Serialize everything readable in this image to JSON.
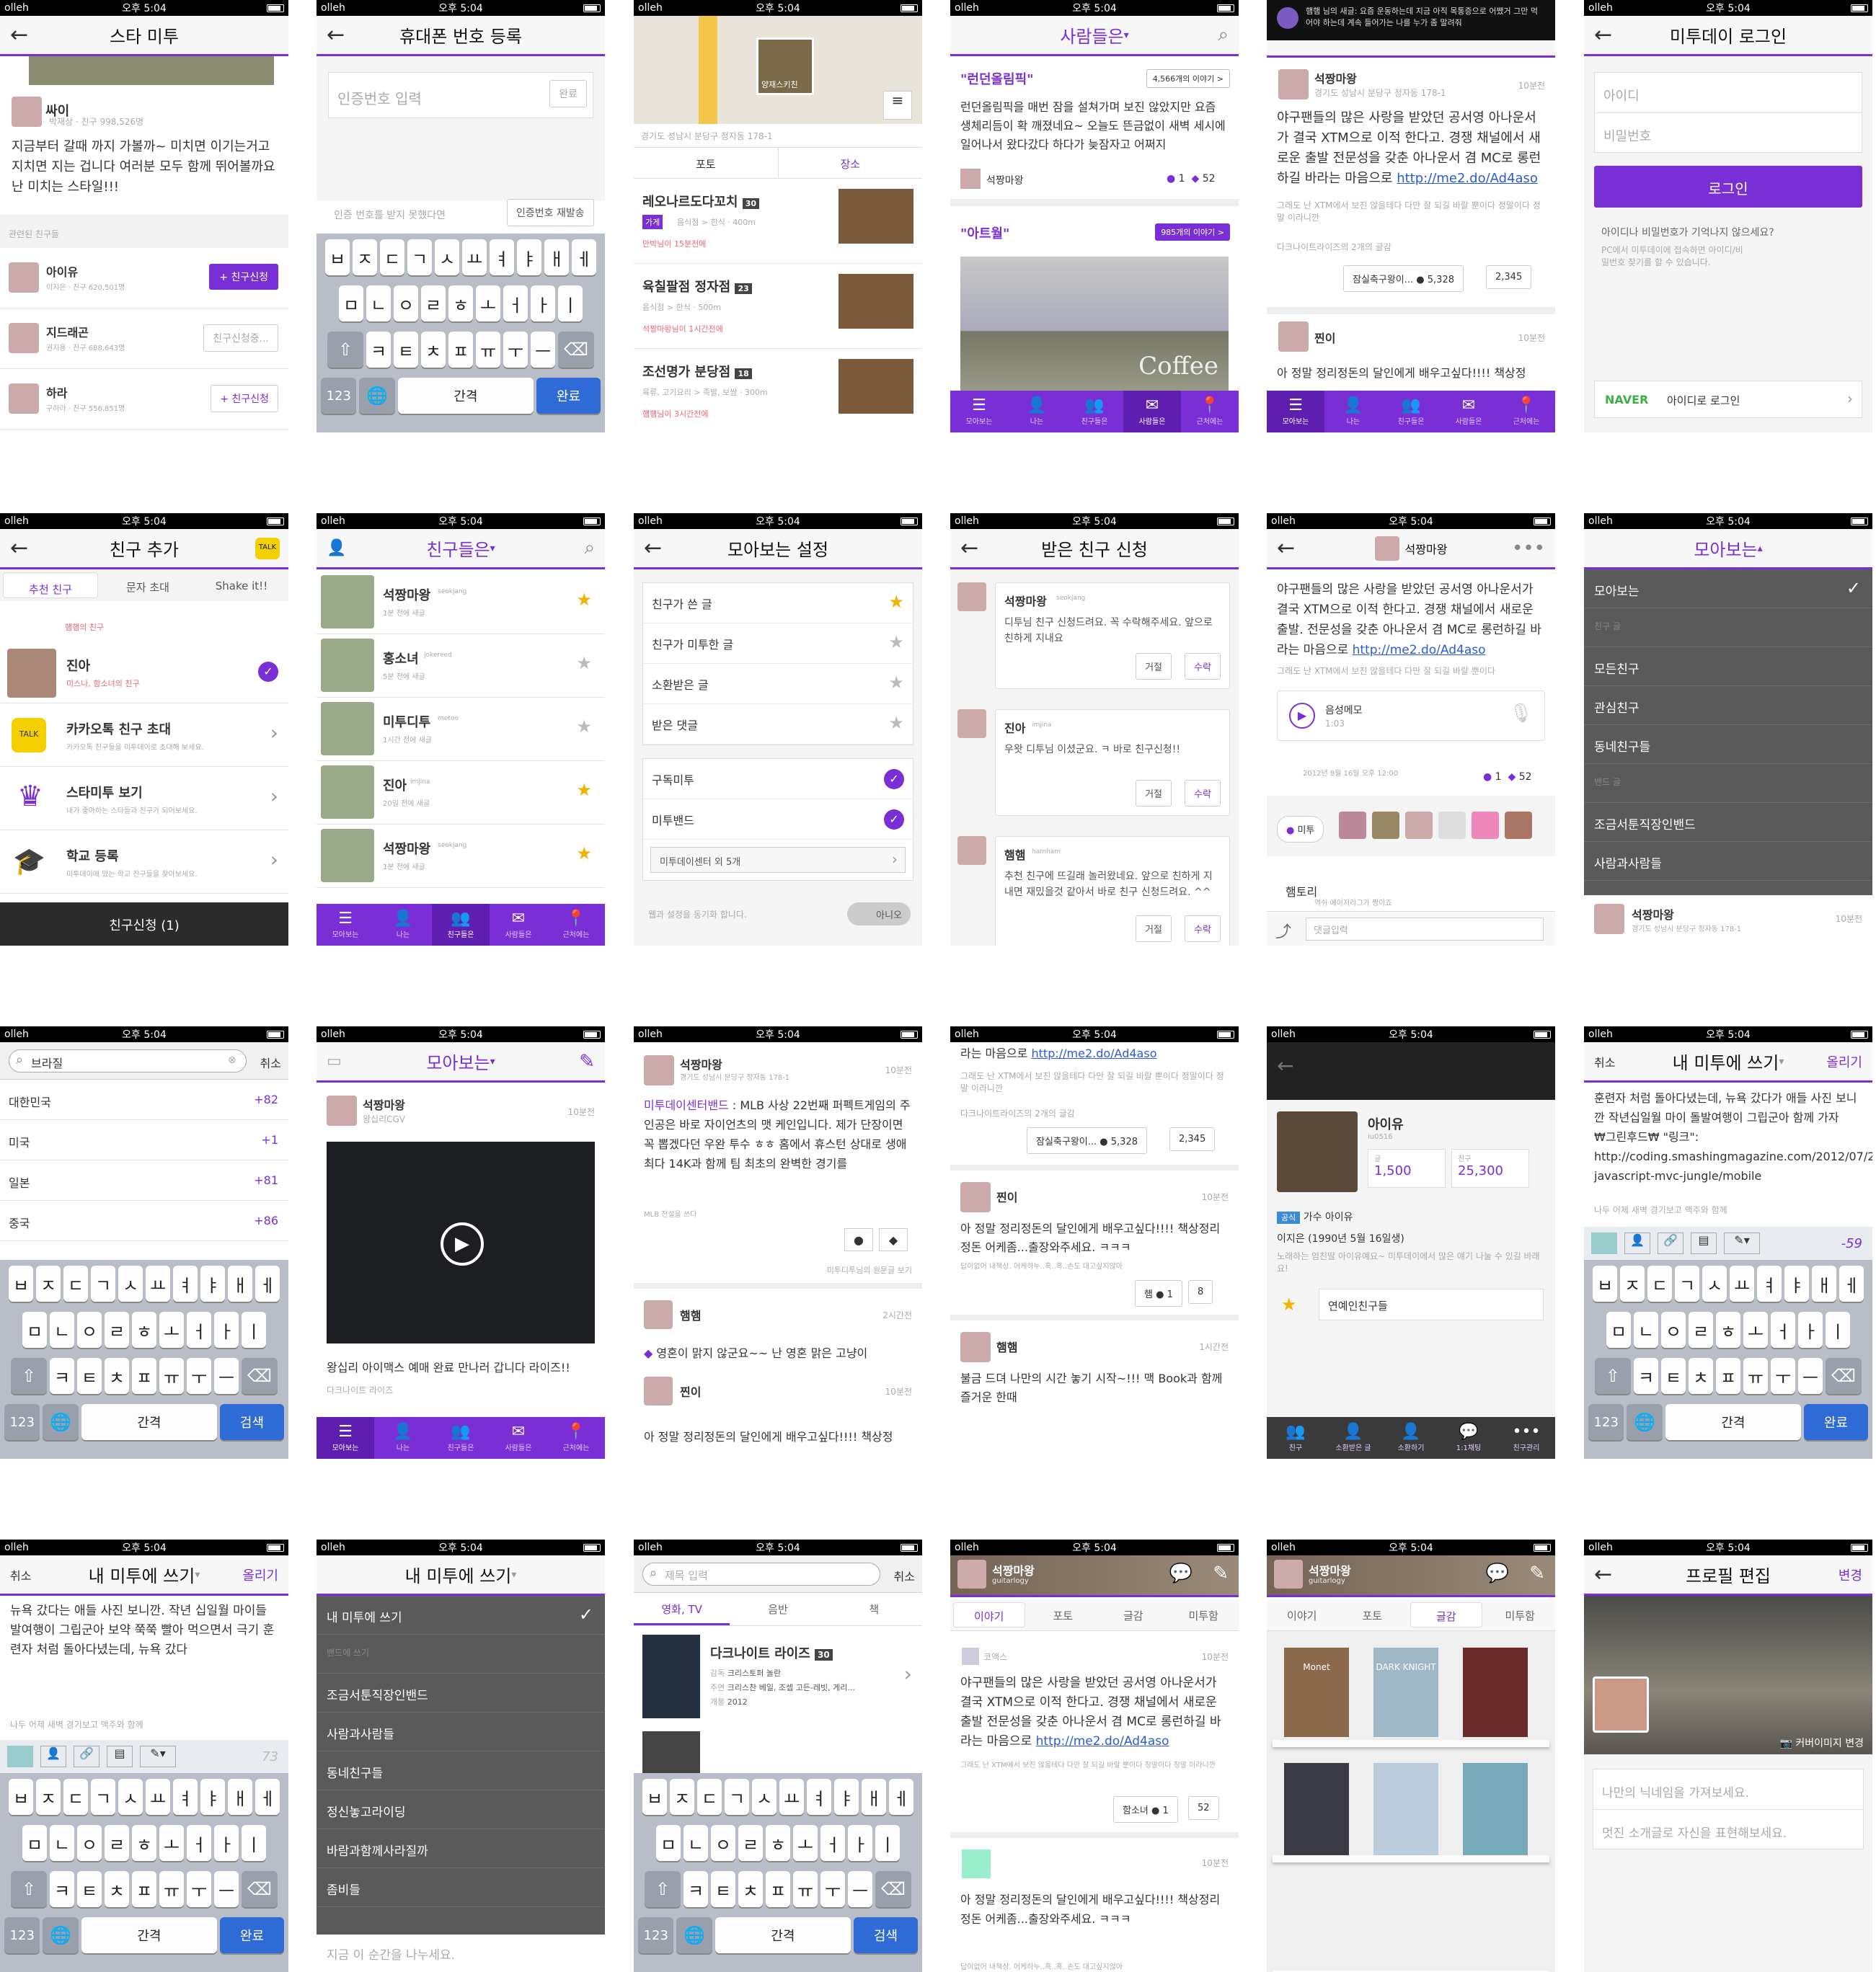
{
  "status": {
    "carrier": "olleh",
    "time": "오후 5:04"
  },
  "tabs": [
    "모아보는",
    "나는",
    "친구들은",
    "사람들은",
    "근처에는"
  ],
  "kb": {
    "r1": [
      "ㅂ",
      "ㅈ",
      "ㄷ",
      "ㄱ",
      "ㅅ",
      "ㅛ",
      "ㅕ",
      "ㅑ",
      "ㅐ",
      "ㅔ"
    ],
    "r2": [
      "ㅁ",
      "ㄴ",
      "ㅇ",
      "ㄹ",
      "ㅎ",
      "ㅗ",
      "ㅓ",
      "ㅏ",
      "ㅣ"
    ],
    "r3": [
      "ㅋ",
      "ㅌ",
      "ㅊ",
      "ㅍ",
      "ㅠ",
      "ㅜ",
      "ㅡ"
    ],
    "num": "123",
    "space": "간격",
    "done": "완료",
    "search": "검색"
  },
  "s1": {
    "title": "스타 미투",
    "name": "싸이",
    "meta": "박재상 · 친구 998,526명",
    "post": "지금부터 갈때 까지 가볼까~ 미치면 이기는거고 지치면 지는 겁니다 여러분 모두 함께 뛰어볼까요 난 미치는 스타일!!!",
    "section": "관련된 친구들",
    "friends": [
      {
        "n": "아이유",
        "m": "이지은 · 친구 620,501명",
        "b": "+ 친구신청"
      },
      {
        "n": "지드래곤",
        "m": "권지용 · 친구 688,643명",
        "b": "친구신청중..."
      },
      {
        "n": "하라",
        "m": "구하라 · 친구 556,851명",
        "b": "+ 친구신청"
      }
    ]
  },
  "s2": {
    "title": "휴대폰 번호 등록",
    "ph": "인증번호 입력",
    "ok": "완료",
    "q": "인증 번호를 받지 못했다면",
    "resend": "인증번호 재발송"
  },
  "s3": {
    "addr": "경기도 성남시 분당구 정자동 178-1",
    "tabs": [
      "포토",
      "장소"
    ],
    "pin": "양재스키친",
    "items": [
      {
        "n": "레오나르도다꼬치",
        "c": "30",
        "t": "가게",
        "m": "음식점 > 한식 · 400m",
        "w": "만박님이 15분전에"
      },
      {
        "n": "육칠팔점 정자점",
        "c": "23",
        "m": "음식점 > 한식 · 500m",
        "w": "석짱마왕님이 1시간전에"
      },
      {
        "n": "조선명가 분당점",
        "c": "18",
        "m": "육류, 고기요리 > 족발, 보쌈 · 300m",
        "w": "햄햄님이 3시간전에"
      }
    ]
  },
  "s4": {
    "title": "사람들은",
    "k1": "\"런던올림픽\"",
    "c1": "4,566개의 이야기 >",
    "p1": "런던올림픽을 매번 잠을 설쳐가며 보진 않았지만 요즘 생체리듬이 확 깨졌네요~ 오늘도 뜬금없이 새벽 세시에 일어나서 왔다갔다 하다가 늦잠자고 어쩌지",
    "u1": "석짱마왕",
    "l1": "1",
    "r1": "52",
    "k2": "\"아트월\"",
    "c2": "985개의 이야기 >",
    "img": "Coffee"
  },
  "s5": {
    "notice": "햄햄 님의 새글: 요즘 운동하는데 지금 아직 목통증으로 어쨌거 그만 먹어야 하는데 계속 들어가는 나를 누가 좀 말려줘",
    "u": "석짱마왕",
    "addr": "경기도 성남시 분당구 정자동 178-1",
    "time": "10분전",
    "post": "야구팬들의 많은 사랑을 받았던 공서영 아나운서가 결국 XTM으로 이적 한다고. 경쟁 채널에서 새로운 출발 전문성을 갖춘 아나운서 겸 MC로 롱런하길 바라는 마음으로",
    "link": "http://me2.do/Ad4aso",
    "sub": "그래도 난 XTM에서 보진 않을테다 다만 잘 되길 바랄 뿐이다 정말이다 정말 이라니깐",
    "tag": "다크나이트라이즈의 2개의 글감",
    "b1": "잠실축구왕이... ● 5,328",
    "b2": "2,345",
    "u2": "찐이",
    "t2": "10분전",
    "p2": "아 정말 정리정돈의 달인에게 배우고싶다!!!! 책상정"
  },
  "s6": {
    "title": "미투데이 로그인",
    "id": "아이디",
    "pw": "비밀번호",
    "login": "로그인",
    "q": "아이디나 비밀번호가 기억나지 않으세요?",
    "help": "PC에서 미투데이에 접속하면 아이디/비밀번호 찾기를 할 수 있습니다.",
    "naver": "NAVER",
    "nlogin": "아이디로 로그인"
  },
  "s7": {
    "title": "친구 추가",
    "tabs": [
      "추천 친구",
      "문자 초대",
      "Shake it!!"
    ],
    "p1": "햄햄의 친구",
    "n2": "진아",
    "s2": "미스나, 함소녀의 친구",
    "kakao": "카카오톡 친구 초대",
    "kakaos": "카카오톡 친구들을 미투데이로 초대해 보세요.",
    "star": "스타미투 보기",
    "stars": "내가 좋아하는 스타들과 친구가 되어보세요.",
    "school": "학교 등록",
    "schools": "미투데이에 있는 학교 친구들을 찾아보세요.",
    "req": "친구신청 (1)"
  },
  "s8": {
    "title": "친구들은",
    "items": [
      {
        "n": "석짱마왕",
        "id": "seokjang",
        "t": "1분 전에 새글"
      },
      {
        "n": "홍소녀",
        "id": "jokereed",
        "t": "5분 전에 새글"
      },
      {
        "n": "미투디투",
        "id": "metoo",
        "t": "1시간 전에 새글"
      },
      {
        "n": "진아",
        "id": "imjina",
        "t": "20일 전에 새글"
      },
      {
        "n": "석짱마왕",
        "id": "seokjang",
        "t": "1분 전에 새글"
      }
    ]
  },
  "s9": {
    "title": "모아보는 설정",
    "g1": [
      "친구가 쓴 글",
      "친구가 미투한 글",
      "소환받은 글",
      "받은 댓글"
    ],
    "g2": [
      "구독미투",
      "미투밴드"
    ],
    "band": "미투데이센터 외 5개",
    "sync": "웹과 설정을 동기화 합니다.",
    "toggle": "아니오"
  },
  "s10": {
    "title": "받은 친구 신청",
    "items": [
      {
        "n": "석짱마왕",
        "id": "seokjang",
        "m": "디투님 친구 신청드려요. 꼭 수락해주세요. 앞으로 친하게 지내요"
      },
      {
        "n": "진아",
        "id": "imjina",
        "m": "우왓 디투님 이셨군요. ㅋ 바로 친구신청!!"
      },
      {
        "n": "햄햄",
        "id": "hamham",
        "m": "추천 친구에 뜨길래 놀러왔네요. 앞으로 친하게 지내면 재밌을것 같아서 바로 친구 신청드려요. ^^"
      }
    ],
    "deny": "거절",
    "accept": "수락"
  },
  "s11": {
    "u": "석짱마왕",
    "id": "guitarlogy",
    "post": "야구팬들의 많은 사랑을 받았던 공서영 아나운서가 결국 XTM으로 이적 한다고. 경쟁 채널에서 새로운 출발. 전문성을 갖춘 아나운서 겸 MC로 롱런하길 바라는 마음으로",
    "link": "http://me2.do/Ad4aso",
    "sub": "그래도 난 XTM에서 보진 않을테다 다만 잘 되길 바랄 뿐이다",
    "voice": "음성메모",
    "vt": "1:03",
    "date": "2012년 8월 16일 오후 12:00",
    "l": "1",
    "r": "52",
    "me": "미투",
    "c": "햄토리",
    "cs": "역쉬 에이저리그가 짱이죠",
    "ph": "댓글입력"
  },
  "s12": {
    "title": "모아보는",
    "items": [
      "모아보는",
      "친구 글",
      "모든친구",
      "관심친구",
      "동네친구들",
      "밴드 글",
      "조금서툰직장인밴드",
      "사람과사람들"
    ],
    "u": "석짱마왕",
    "addr": "경기도 성남시 분당구 정자동 178-1",
    "t": "10분전"
  },
  "s13": {
    "q": "브라질",
    "cancel": "취소",
    "rows": [
      {
        "n": "대한민국",
        "v": "+82"
      },
      {
        "n": "미국",
        "v": "+1"
      },
      {
        "n": "일본",
        "v": "+81"
      },
      {
        "n": "중국",
        "v": "+86"
      }
    ]
  },
  "s14": {
    "title": "모아보는",
    "u": "석짱마왕",
    "sub": "왕십리CGV",
    "t": "10분전",
    "post": "왕십리 아이맥스 예매 완료 만나러 갑니다 라이즈!!",
    "tag": "다크나이트 라이즈"
  },
  "s15": {
    "u": "석짱마왕",
    "addr": "경기도 성남시 분당구 정자동 178-1",
    "t": "10분전",
    "band": "미투데이센터밴드",
    "post": "MLB 사상 22번째 퍼펙트게임의 주인공은 바로 자이언츠의 맷 케인입니다. 제가 단장이면 꼭 뽑겠다던 우완 투수 ㅎㅎ 홈에서 휴스턴 상대로 생애 최다 14K과 함께 팀 최초의 완벽한 경기를",
    "tag": "MLB 전설을 쓰다",
    "orig": "미투디투님의 원문글 보기",
    "u2": "햄햄",
    "t2": "2시간전",
    "p2": "영혼이 맑지 않군요~~ 난 영혼 맑은 고냥이",
    "u3": "찐이",
    "t3": "10분전",
    "p3": "아 정말 정리정돈의 달인에게 배우고싶다!!!! 책상정"
  },
  "s16": {
    "top": "라는 마음으로",
    "link": "http://me2.do/Ad4aso",
    "sub": "그래도 난 XTM에서 보진 않을테다 다만 잘 되길 바랄 뿐이다 정말이다 정말 이라니깐",
    "tag": "다크나이트라이즈의 2개의 글감",
    "b1": "잠실축구왕이... ● 5,328",
    "b2": "2,345",
    "u2": "찐이",
    "t2": "10분전",
    "p2": "아 정말 정리정돈의 달인에게 배우고싶다!!!! 책상정리정돈 어케좀...출장와주세요. ㅋㅋㅋ",
    "s2": "답이없어 내책상. 어케하누..흑..흑..손도 대고싶지않아",
    "b3": "햄 ● 1",
    "b4": "8",
    "u3": "햄햄",
    "t3": "1시간전",
    "p3": "불금 드뎌 나만의 시간 놓기 시작~!!! 맥 Book과 함께 즐거운 한때"
  },
  "s17": {
    "n": "아이유",
    "id": "iu0516",
    "f1l": "글",
    "f1": "1,500",
    "f2l": "친구",
    "f2": "25,300",
    "badge": "공식",
    "desc": "가수 아이유",
    "bio": "이지은 (1990년 5월 16일생)",
    "bio2": "노래하는 엄친딸 아이유예요~ 미투데이에서 많은 얘기 나눌 수 있길 바래요!",
    "grp": "연예인친구들",
    "tabs": [
      "친구",
      "소환받은 글",
      "소환하기",
      "1:1채팅",
      "친구관리"
    ]
  },
  "s18": {
    "cancel": "취소",
    "title": "내 미투에 쓰기",
    "post": "올리기",
    "text": "훈련자 처럼 돌아다녔는데, 뉴욕 갔다가 애들 사진 보니깐 작년십일월 마이 돌발여행이 그립군아 함께 가자 ₩그린후드₩ \"링크\": http://coding.smashingmagazine.com/2012/07/27/journey-javascript-mvc-jungle/mobile",
    "tag": "나두 어제 새벽 경기보고 맥주와 함께",
    "count": "-59"
  },
  "s19": {
    "cancel": "취소",
    "title": "내 미투에 쓰기",
    "post": "올리기",
    "text": "뉴욕 갔다는 애들 사진 보니깐. 작년 십일월 마이들 발여행이 그립군아 보약 쭉쭉 빨아 먹으면서 극기 훈련자 처럼 돌아다녔는데, 뉴욕 갔다",
    "tag": "나두 어제 새벽 경기보고 맥주와 함께",
    "count": "73"
  },
  "s20": {
    "title": "내 미투에 쓰기",
    "items": [
      "내 미투에 쓰기",
      "밴드에 쓰기",
      "조금서툰직장인밴드",
      "사람과사람들",
      "동네친구들",
      "정신놓고라이딩",
      "바람과함께사라질까",
      "좀비들"
    ],
    "ph": "지금 이 순간을 나누세요."
  },
  "s21": {
    "ph": "제목 입력",
    "cancel": "취소",
    "tabs": [
      "영화, TV",
      "음반",
      "책"
    ],
    "movie": "다크나이트 라이즈",
    "rate": "30",
    "d": "크리스토퍼 놀란",
    "c": "크리스찬 베일, 조셉 고든-레빗, 게리...",
    "y": "2012",
    "dl": "감독",
    "cl": "주연",
    "yl": "개봉"
  },
  "s22": {
    "u": "석짱마왕",
    "id": "guitarlogy",
    "tabs": [
      "이야기",
      "포토",
      "글감",
      "미투함"
    ],
    "w": "코액스",
    "t": "10분전",
    "post": "야구팬들의 많은 사랑을 받았던 공서영 아나운서가 결국 XTM으로 이적 한다고. 경쟁 채널에서 새로운 출발 전문성을 갖춘 아나운서 겸 MC로 롱런하길 바라는 마음으로",
    "link": "http://me2.do/Ad4aso",
    "sub": "그래도 난 XTM에서 보진 않을테다 다만 잘 되길 바랄 뿐이다 정말이다 정말 이라니깐",
    "b1": "함소녀 ● 1",
    "b2": "52",
    "t2": "10분전",
    "p2": "아 정말 정리정돈의 달인에게 배우고싶다!!!! 책상정리정돈 어케좀...출장와주세요. ㅋㅋㅋ",
    "s2": "답이없어 내책상. 어케하누..흑..흑..손도 대고싶지않아"
  },
  "s23": {
    "u": "석짱마왕",
    "id": "guitarlogy",
    "tabs": [
      "이야기",
      "포토",
      "글감",
      "미투함"
    ],
    "books": [
      "Monet",
      "DARK KNIGHT",
      "",
      "",
      "",
      ""
    ]
  },
  "s24": {
    "title": "프로필 편집",
    "save": "변경",
    "cover": "커버이미지 변경",
    "nick": "나만의 닉네임을 가져보세요.",
    "intro": "멋진 소개글로 자신을 표현해보세요."
  }
}
